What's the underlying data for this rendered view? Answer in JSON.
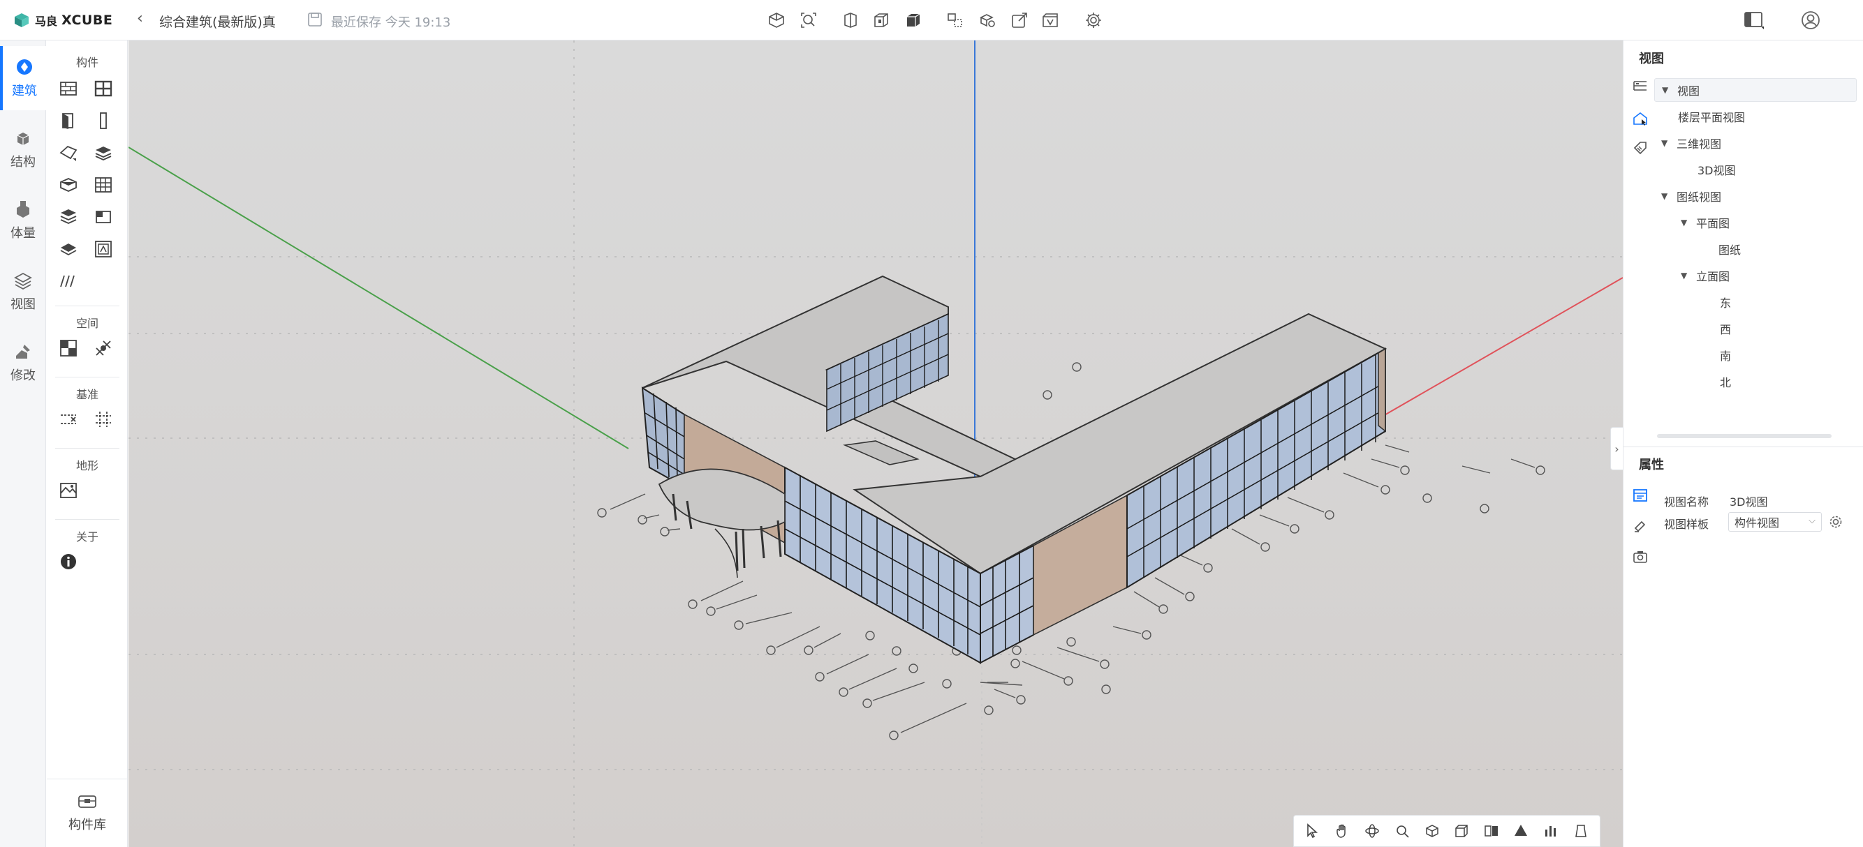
{
  "app": {
    "brand": "XCUBE",
    "brand_prefix": "马良",
    "project_title": "综合建筑(最新版)真",
    "save_status": "最近保存 今天 19:13"
  },
  "toolbar": {
    "icons": [
      "cube-view-icon",
      "zoom-fit-icon",
      "view-front-icon",
      "view-box-icon",
      "view-solid-icon",
      "section-icon",
      "model-settings-icon",
      "export-icon",
      "view-box-v-icon",
      "settings-gear-icon"
    ]
  },
  "rail": {
    "items": [
      {
        "label": "建筑",
        "icon": "building-icon",
        "active": true
      },
      {
        "label": "结构",
        "icon": "structure-icon",
        "active": false
      },
      {
        "label": "体量",
        "icon": "mass-icon",
        "active": false
      },
      {
        "label": "视图",
        "icon": "layers-icon",
        "active": false
      },
      {
        "label": "修改",
        "icon": "modify-icon",
        "active": false
      }
    ]
  },
  "palette": {
    "sections": {
      "components": "构件",
      "space": "空间",
      "datum": "基准",
      "terrain": "地形",
      "about": "关于"
    },
    "library_label": "构件库"
  },
  "right_panel": {
    "view_title": "视图",
    "tree": [
      {
        "label": "视图",
        "level": 0,
        "expanded": true,
        "selected": true
      },
      {
        "label": "楼层平面视图",
        "level": 1,
        "expanded": null
      },
      {
        "label": "三维视图",
        "level": 0,
        "expanded": true
      },
      {
        "label": "3D视图",
        "level": 2,
        "expanded": null
      },
      {
        "label": "图纸视图",
        "level": 0,
        "expanded": true
      },
      {
        "label": "平面图",
        "level": 1,
        "expanded": true
      },
      {
        "label": "图纸",
        "level": 3,
        "expanded": null
      },
      {
        "label": "立面图",
        "level": 1,
        "expanded": true
      },
      {
        "label": "东",
        "level": 3,
        "expanded": null
      },
      {
        "label": "西",
        "level": 3,
        "expanded": null
      },
      {
        "label": "南",
        "level": 3,
        "expanded": null
      },
      {
        "label": "北",
        "level": 3,
        "expanded": null
      }
    ],
    "props_title": "属性",
    "props": {
      "view_name_label": "视图名称",
      "view_name_value": "3D视图",
      "view_template_label": "视图样板",
      "view_template_value": "构件视图"
    }
  },
  "bottom_toolbar": {
    "icons": [
      "select-arrow-icon",
      "pan-hand-icon",
      "orbit-icon",
      "zoom-icon",
      "iso-view-icon",
      "box-view-icon",
      "section-box-icon",
      "surface-icon",
      "chart-icon",
      "clear-icon"
    ]
  },
  "colors": {
    "accent": "#1677ff",
    "axis_x": "#e0525a",
    "axis_y": "#4aa04a",
    "axis_z": "#3a78d8",
    "wall": "#c9b3a3",
    "roof": "#c7c6c5",
    "glass": "#b8c8e0"
  }
}
